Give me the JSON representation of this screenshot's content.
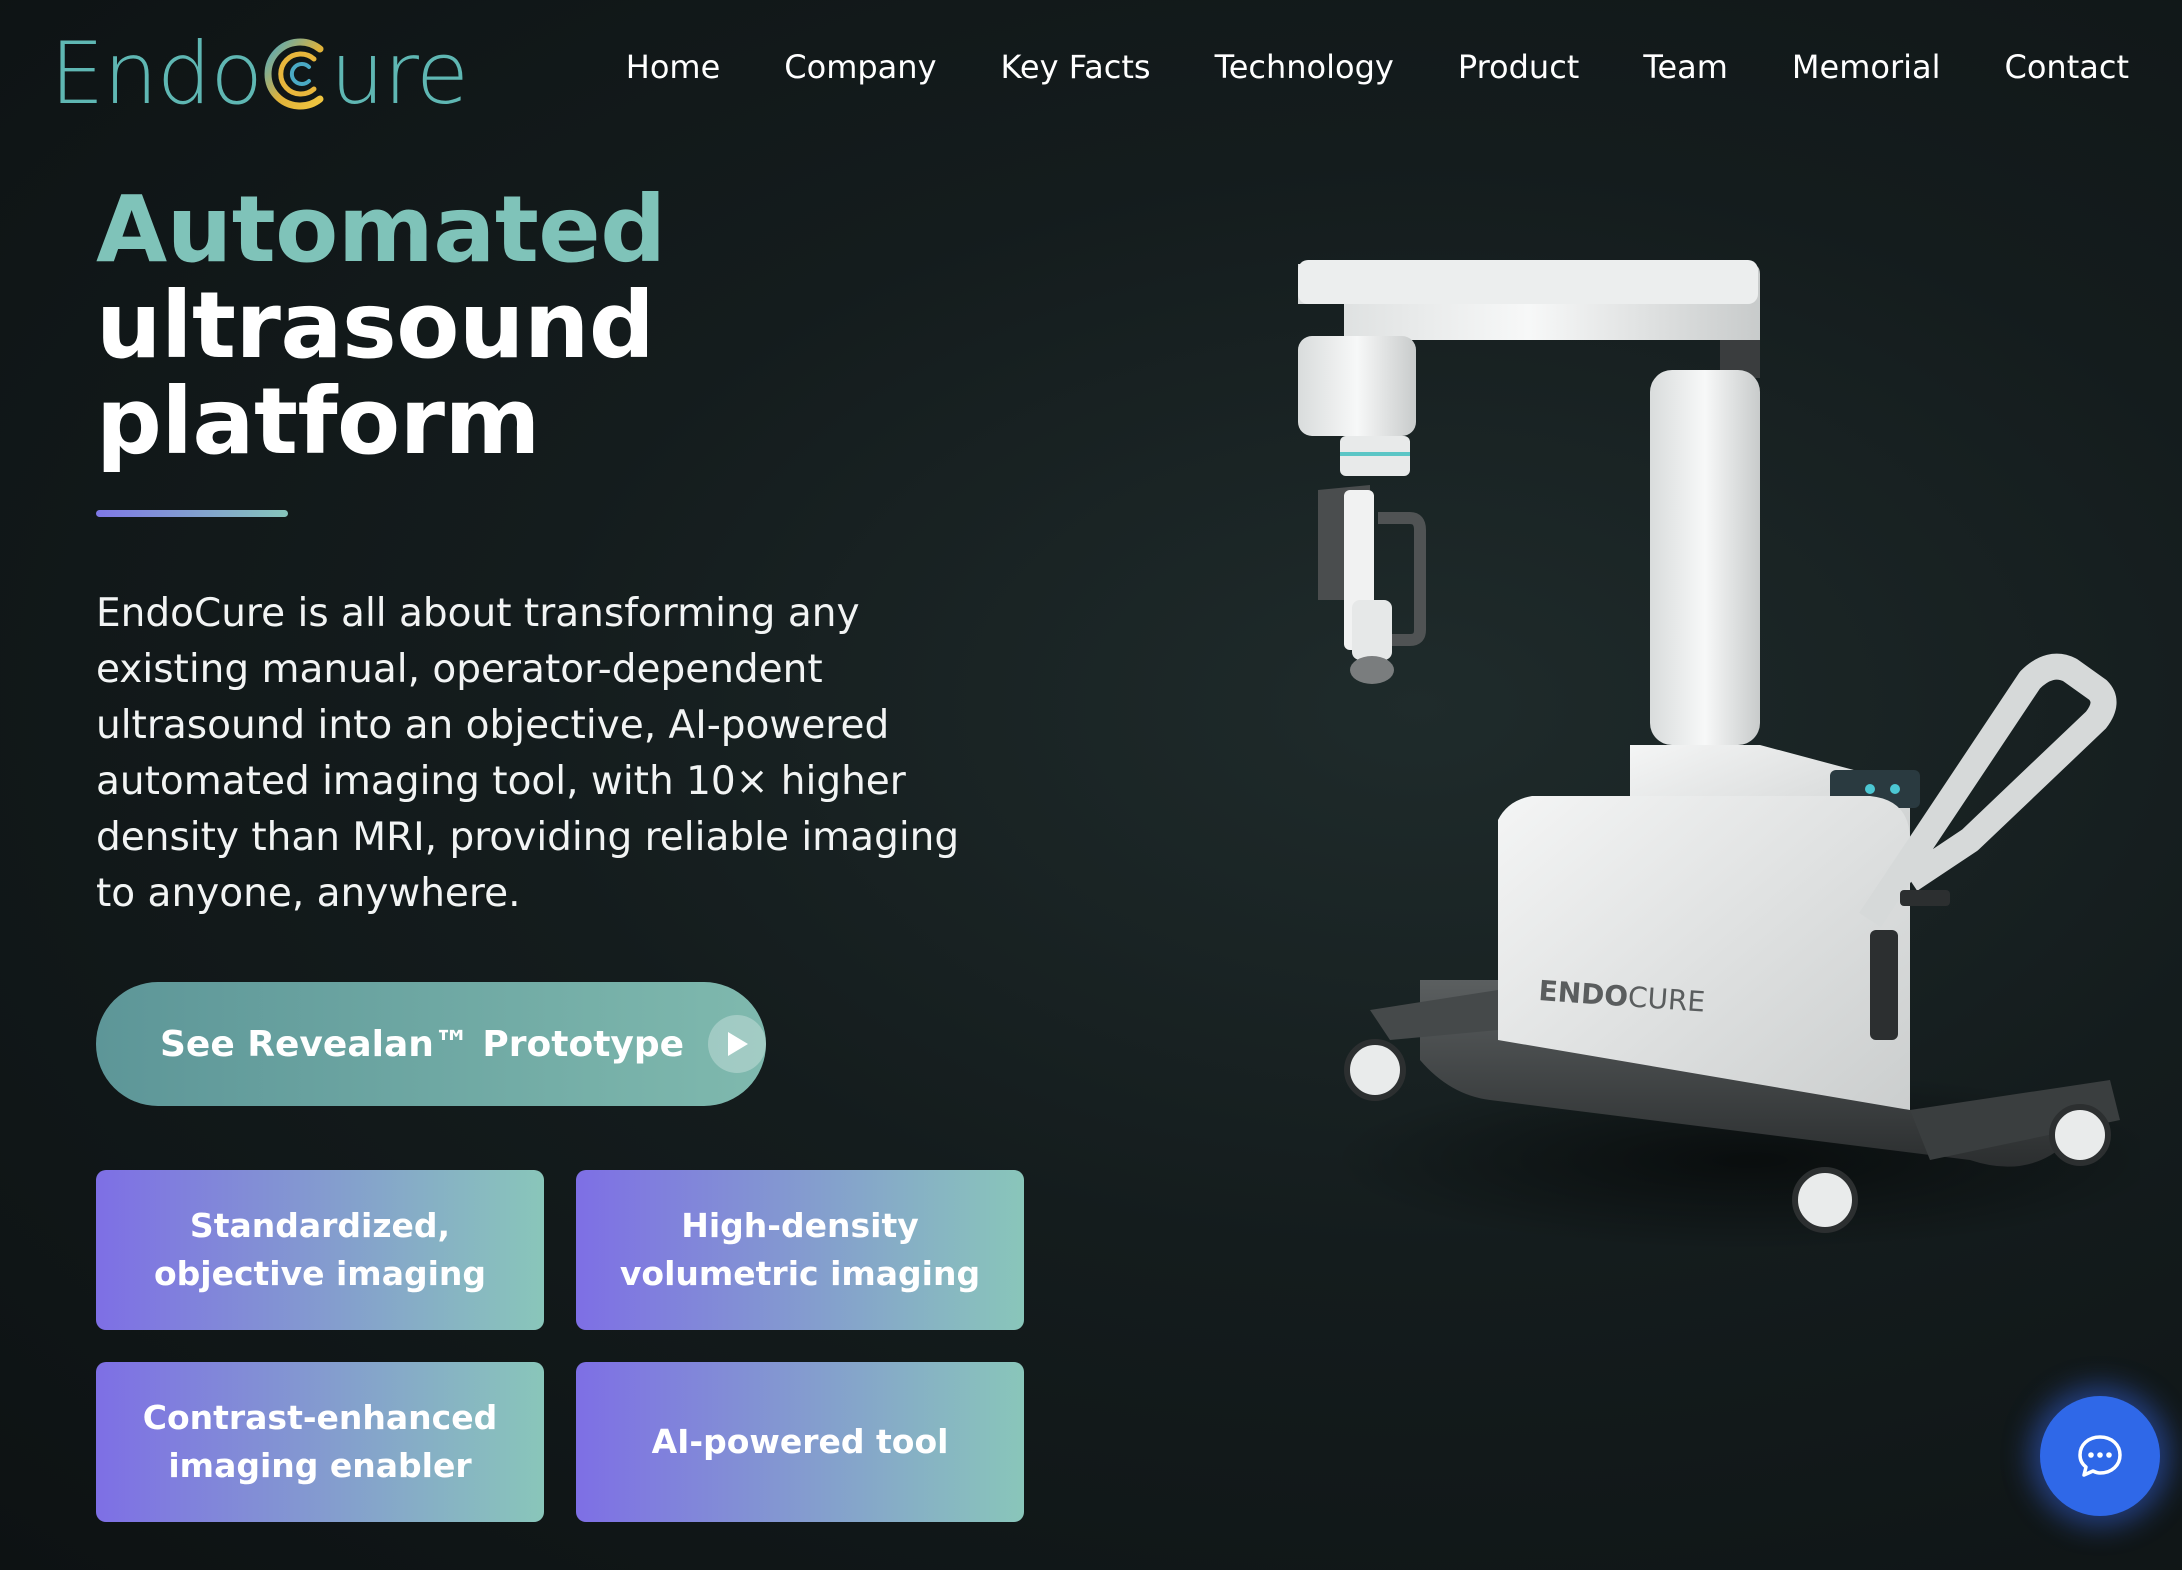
{
  "brand": {
    "name_start": "Endo",
    "name_end": "ure",
    "logo_color": "#5fb7b3"
  },
  "nav": {
    "items": [
      {
        "label": "Home"
      },
      {
        "label": "Company"
      },
      {
        "label": "Key Facts"
      },
      {
        "label": "Technology"
      },
      {
        "label": "Product"
      },
      {
        "label": "Team"
      },
      {
        "label": "Memorial"
      },
      {
        "label": "Contact"
      }
    ]
  },
  "hero": {
    "title_line1": "Automated",
    "title_line2": "ultrasound",
    "title_line3": "platform",
    "description": "EndoCure is all about transforming any existing manual, operator-dependent ultrasound into an objective, AI-powered automated imaging tool, with 10× higher density than MRI, providing reliable imaging to anyone, anywhere.",
    "cta_label": "See Revealan™ Prototype",
    "cta_icon": "play-icon"
  },
  "features": [
    {
      "label": "Standardized, objective imaging"
    },
    {
      "label": "High-density volumetric imaging"
    },
    {
      "label": "Contrast-enhanced imaging enabler"
    },
    {
      "label": "AI-powered tool"
    }
  ],
  "product": {
    "device_label_bold": "ENDO",
    "device_label_light": "CURE"
  },
  "chat": {
    "icon": "chat-bubble-icon",
    "color": "#2f68e8"
  },
  "colors": {
    "accent_teal": "#7fc3b9",
    "accent_purple": "#7e6fe5",
    "background": "#141c1d"
  }
}
